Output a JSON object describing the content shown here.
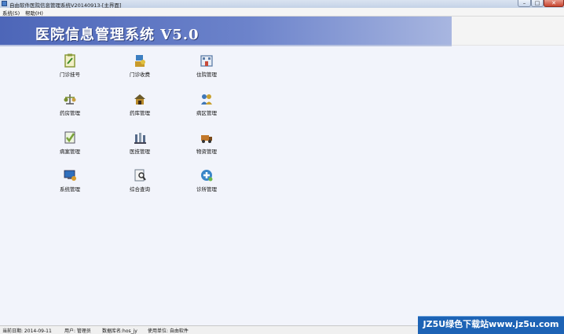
{
  "window": {
    "title": "自由软件医院信息管理系统V20140913-[主界面]",
    "controls": {
      "minimize": "–",
      "maximize": "□",
      "close": "✕"
    }
  },
  "menu": {
    "system": "系统(S)",
    "help": "帮助(H)"
  },
  "banner": {
    "title": "医院信息管理系统 V5.0"
  },
  "modules": [
    {
      "label": "门诊挂号",
      "icon": "clipboard-icon",
      "color": "#8a9a3a"
    },
    {
      "label": "门诊收费",
      "icon": "cashier-icon",
      "color": "#3d7fc1"
    },
    {
      "label": "住院管理",
      "icon": "ward-building-icon",
      "color": "#5d7ea8"
    },
    {
      "label": "药房管理",
      "icon": "scale-icon",
      "color": "#7a8f2f"
    },
    {
      "label": "药库管理",
      "icon": "warehouse-icon",
      "color": "#b88a2a"
    },
    {
      "label": "病区管理",
      "icon": "people-group-icon",
      "color": "#3f77b7"
    },
    {
      "label": "病案管理",
      "icon": "checked-record-icon",
      "color": "#7aa33a"
    },
    {
      "label": "医技管理",
      "icon": "lab-instruments-icon",
      "color": "#556a8a"
    },
    {
      "label": "物资管理",
      "icon": "truck-icon",
      "color": "#c2782a"
    },
    {
      "label": "系统管理",
      "icon": "computer-settings-icon",
      "color": "#2f6fbd"
    },
    {
      "label": "综合查询",
      "icon": "search-document-icon",
      "color": "#6c7a8a"
    },
    {
      "label": "诊所管理",
      "icon": "clinic-network-icon",
      "color": "#3a86c8"
    }
  ],
  "status": {
    "date": "当前日期:   2014-09-11",
    "user": "用户:  管理员",
    "db": "数据库名:hos_jy",
    "unit": "使用单位:  自由软件"
  },
  "watermark": {
    "text": "JZ5U绿色下载站www.jz5u.com"
  }
}
